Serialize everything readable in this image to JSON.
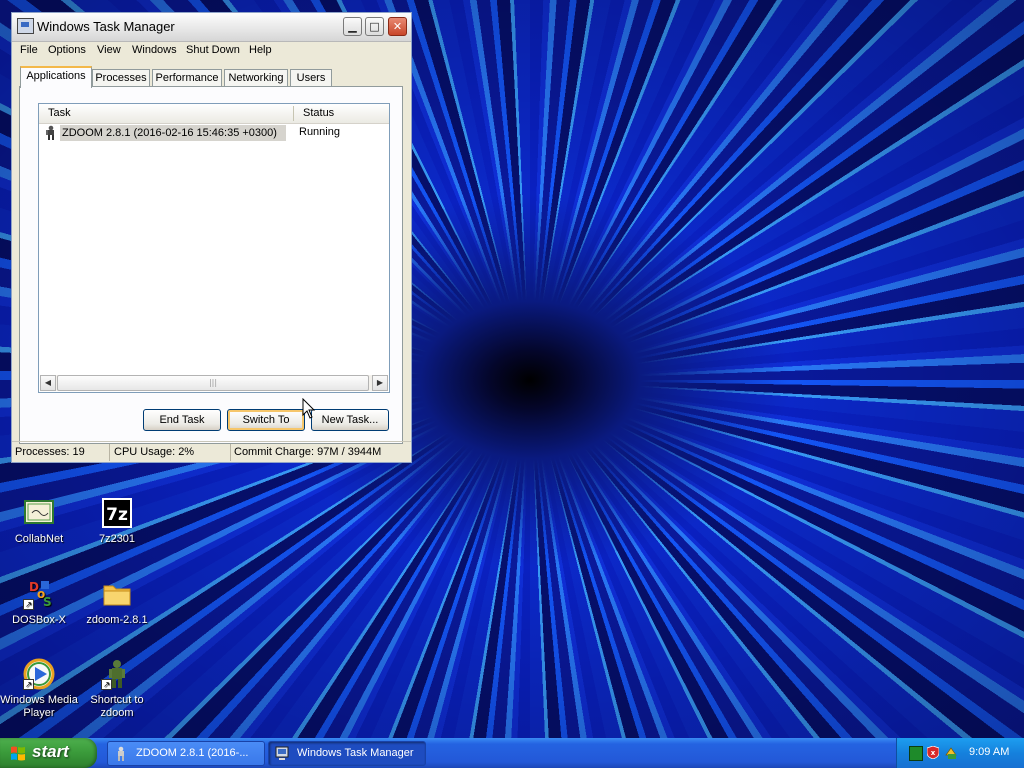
{
  "window": {
    "title": "Windows Task Manager",
    "menu": [
      "File",
      "Options",
      "View",
      "Windows",
      "Shut Down",
      "Help"
    ],
    "tabs": [
      "Applications",
      "Processes",
      "Performance",
      "Networking",
      "Users"
    ],
    "active_tab": "Applications",
    "list": {
      "columns": [
        "Task",
        "Status"
      ],
      "rows": [
        {
          "task": "ZDOOM 2.8.1  (2016-02-16 15:46:35 +0300)",
          "status": "Running"
        }
      ]
    },
    "buttons": {
      "end_task": "End Task",
      "switch_to": "Switch To",
      "new_task": "New Task..."
    },
    "statusbar": {
      "processes": "Processes: 19",
      "cpu": "CPU Usage: 2%",
      "commit": "Commit Charge: 97M / 3944M"
    }
  },
  "desktop": {
    "icons": [
      {
        "label": "CollabNet",
        "icon": "certificate-icon"
      },
      {
        "label": "7z2301",
        "icon": "7zip-icon"
      },
      {
        "label": "DOSBox-X",
        "icon": "dosbox-icon"
      },
      {
        "label": "zdoom-2.8.1",
        "icon": "folder-icon"
      },
      {
        "label": "Windows Media Player",
        "icon": "media-player-icon"
      },
      {
        "label": "Shortcut to zdoom",
        "icon": "doom-marine-icon"
      }
    ]
  },
  "taskbar": {
    "start_label": "start",
    "tasks": [
      {
        "label": "ZDOOM 2.8.1  (2016-...",
        "active": false
      },
      {
        "label": "Windows Task Manager",
        "active": true
      }
    ],
    "clock": "9:09 AM"
  },
  "colors": {
    "taskbar_blue": "#2358d8",
    "start_green": "#3a9a3a",
    "window_face": "#ece9d8",
    "tab_highlight": "#f3b84a"
  }
}
